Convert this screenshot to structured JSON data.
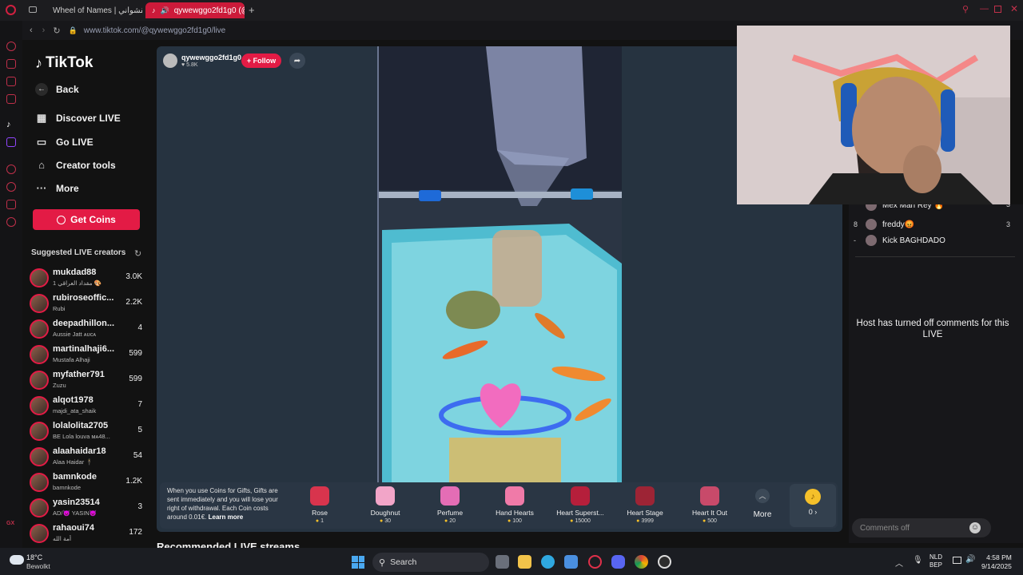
{
  "browser": {
    "tabs": [
      {
        "label": "Wheel of Names | حقشواني"
      },
      {
        "label": "qywewggo2fd1g0 (@q"
      }
    ],
    "url": "www.tiktok.com/@qywewggo2fd1g0/live"
  },
  "tiktok": {
    "logo": "TikTok",
    "nav": [
      {
        "label": "Back",
        "icon": "back-arrow-icon"
      },
      {
        "label": "Discover LIVE",
        "icon": "calendar-live-icon"
      },
      {
        "label": "Go LIVE",
        "icon": "camera-icon"
      },
      {
        "label": "Creator tools",
        "icon": "lightbulb-icon"
      },
      {
        "label": "More",
        "icon": "ellipsis-icon"
      }
    ],
    "get_coins": "Get Coins",
    "suggested_title": "Suggested LIVE creators",
    "creators": [
      {
        "name": "mukdad88",
        "sub": "1 مقداد العراقي 🎨",
        "viewers": "3.0K"
      },
      {
        "name": "rubiroseoffic...",
        "sub": "Rubi",
        "viewers": "2.2K"
      },
      {
        "name": "deepadhillon...",
        "sub": "Aussie Jatt ᴀᴜᴄᴀ",
        "viewers": "4"
      },
      {
        "name": "martinalhaji6...",
        "sub": "Mustafa Alhaji",
        "viewers": "599"
      },
      {
        "name": "myfather791",
        "sub": "Zuzu",
        "viewers": "599"
      },
      {
        "name": "alqot1978",
        "sub": "majdi_ata_shaik",
        "viewers": "7"
      },
      {
        "name": "lolalolita2705",
        "sub": "BE Lola louva ᴍᴀ48...",
        "viewers": "5"
      },
      {
        "name": "alaahaidar18",
        "sub": "Alaa Haidar 🕴",
        "viewers": "54"
      },
      {
        "name": "bamnkode",
        "sub": "bamnkode",
        "viewers": "1.2K"
      },
      {
        "name": "yasin23514",
        "sub": "AD/😈 YASIN😈",
        "viewers": "3"
      },
      {
        "name": "rahaoui74",
        "sub": "أمة الله",
        "viewers": "172"
      }
    ]
  },
  "live": {
    "host": "qywewggo2fd1g0",
    "likes": "5.8K",
    "follow": "+ Follow",
    "coin_note": "When you use Coins for Gifts, Gifts are sent immediately and you will lose your right of withdrawal. Each Coin costs around 0.01€.",
    "learn_more": "Learn more",
    "gifts": [
      {
        "name": "Rose",
        "price": "1",
        "color": "#d8344d"
      },
      {
        "name": "Doughnut",
        "price": "30",
        "color": "#f2a5c8"
      },
      {
        "name": "Perfume",
        "price": "20",
        "color": "#e46db5"
      },
      {
        "name": "Hand Hearts",
        "price": "100",
        "color": "#f07aa8"
      },
      {
        "name": "Heart Superst...",
        "price": "15000",
        "color": "#b51f3b"
      },
      {
        "name": "Heart Stage",
        "price": "3999",
        "color": "#9d2435"
      },
      {
        "name": "Heart It Out",
        "price": "500",
        "color": "#c84a6a"
      }
    ],
    "more": "More",
    "coins": "0 ›",
    "recommended": "Recommended LIVE streams"
  },
  "chat": {
    "ranking": [
      {
        "rank": "",
        "name": "Mex Man Rey 🔥",
        "score": "3"
      },
      {
        "rank": "8",
        "name": "freddy😡",
        "score": "3"
      },
      {
        "rank": "-",
        "name": "Kick BAGHDADO",
        "score": ""
      }
    ],
    "off_message": "Host has turned off comments for this LIVE",
    "input_placeholder": "Comments off"
  },
  "taskbar": {
    "temp": "18°C",
    "weather": "Bewolkt",
    "search": "Search",
    "lang": "NLD",
    "layout": "BEP",
    "time": "4:58 PM",
    "date": "9/14/2025"
  }
}
